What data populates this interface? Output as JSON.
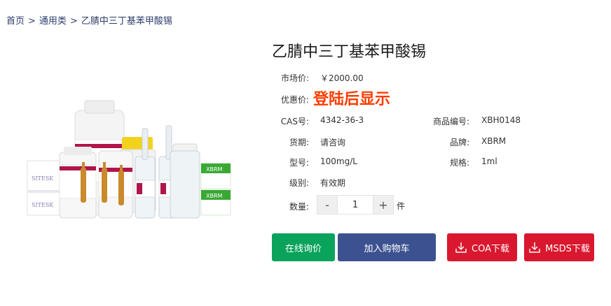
{
  "breadcrumb": {
    "home": "首页",
    "separator": ">",
    "category": "通用类",
    "current": "乙腈中三丁基苯甲酸锡"
  },
  "product": {
    "title": "乙腈中三丁基苯甲酸锡",
    "market_price_label": "市场价:",
    "market_price": "￥2000.00",
    "promo_price_label": "优惠价:",
    "promo_price": "登陆后显示",
    "cas_label": "CAS号:",
    "cas": "4342-36-3",
    "sku_label": "商品编号:",
    "sku": "XBH0148",
    "delivery_label": "货期:",
    "delivery": "请咨询",
    "brand_label": "品牌:",
    "brand": "XBRM",
    "model_label": "型号:",
    "model": "100mg/L",
    "spec_label": "规格:",
    "spec": "1ml",
    "grade_label": "级别:",
    "grade": "有效期",
    "quantity_label": "数量:",
    "quantity": "1",
    "quantity_unit": "件",
    "minus": "-",
    "plus": "+"
  },
  "image": {
    "label_sitesk": "SITESK",
    "label_xbrm": "XBRM"
  },
  "actions": {
    "inquiry": "在线询价",
    "add_to_cart": "加入购物车",
    "coa_download": "COA下载",
    "msds_download": "MSDS下载"
  },
  "colors": {
    "breadcrumb": "#2d3d6b",
    "promo": "#ff3c00",
    "inquiry_button": "#09a35b",
    "cart_button": "#3c5290",
    "download_button": "#d9172e"
  },
  "icons": {
    "download": "download-icon"
  }
}
